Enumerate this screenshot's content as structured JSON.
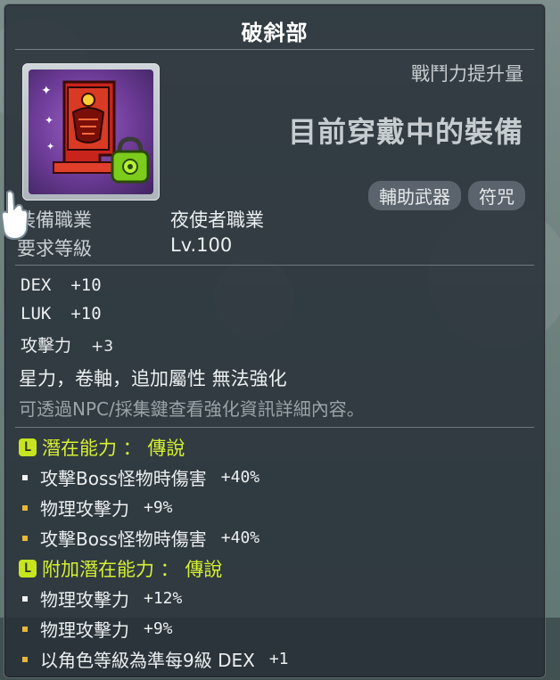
{
  "item": {
    "name": "破斜部",
    "combat_power_label": "戰鬥力提升量",
    "equipped_label": "目前穿戴中的裝備",
    "tags": [
      "輔助武器",
      "符咒"
    ],
    "icon": "red-talisman-with-lock-icon"
  },
  "requirements": {
    "job_label": "裝備職業",
    "job_value": "夜使者職業",
    "level_label": "要求等級",
    "level_value": "Lv.100"
  },
  "stats": [
    {
      "name": "DEX",
      "value": "+10"
    },
    {
      "name": "LUK",
      "value": "+10"
    },
    {
      "name": "攻擊力",
      "value": "+3"
    }
  ],
  "notes": {
    "restriction": "星力，卷軸，追加屬性 無法強化",
    "hint": "可透過NPC/採集鍵查看強化資訊詳細內容。"
  },
  "potential": {
    "badge": "L",
    "header": "潛在能力 ： 傳說",
    "lines": [
      {
        "text": "攻擊Boss怪物時傷害",
        "value": "+40%"
      },
      {
        "text": "物理攻擊力",
        "value": "+9%"
      },
      {
        "text": "攻擊Boss怪物時傷害",
        "value": "+40%"
      }
    ]
  },
  "additional_potential": {
    "badge": "L",
    "header": "附加潛在能力 ： 傳說",
    "lines": [
      {
        "text": "物理攻擊力",
        "value": "+12%"
      },
      {
        "text": "物理攻擊力",
        "value": "+9%"
      },
      {
        "text": "以角色等級為準每9級 DEX",
        "value": "+1"
      }
    ]
  },
  "colors": {
    "potential_yellow": "#d6f032",
    "bullet_white": "#f2f2f2",
    "bullet_gold": "#e8b73a",
    "panel_bg": "#28303a"
  }
}
